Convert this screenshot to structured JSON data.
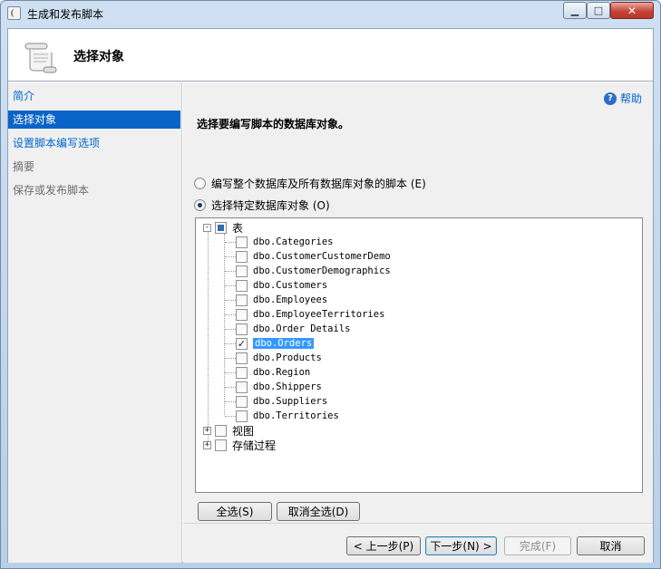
{
  "window": {
    "title": "生成和发布脚本",
    "buttons": {
      "minimize": "▁",
      "maximize": "□",
      "close": "✕"
    }
  },
  "header": {
    "title": "选择对象",
    "icon": "scroll-icon"
  },
  "nav": {
    "items": [
      {
        "label": "简介",
        "state": "link"
      },
      {
        "label": "选择对象",
        "state": "selected"
      },
      {
        "label": "设置脚本编写选项",
        "state": "link"
      },
      {
        "label": "摘要",
        "state": "disabled"
      },
      {
        "label": "保存或发布脚本",
        "state": "disabled"
      }
    ]
  },
  "main": {
    "help": "帮助",
    "instruction": "选择要编写脚本的数据库对象。",
    "radio_all": "编写整个数据库及所有数据库对象的脚本 (E)",
    "radio_specific": "选择特定数据库对象 (O)",
    "tree": {
      "tables_label": "表",
      "tables": [
        {
          "name": "dbo.Categories",
          "checked": false
        },
        {
          "name": "dbo.CustomerCustomerDemo",
          "checked": false
        },
        {
          "name": "dbo.CustomerDemographics",
          "checked": false
        },
        {
          "name": "dbo.Customers",
          "checked": false
        },
        {
          "name": "dbo.Employees",
          "checked": false
        },
        {
          "name": "dbo.EmployeeTerritories",
          "checked": false
        },
        {
          "name": "dbo.Order Details",
          "checked": false
        },
        {
          "name": "dbo.Orders",
          "checked": true
        },
        {
          "name": "dbo.Products",
          "checked": false
        },
        {
          "name": "dbo.Region",
          "checked": false
        },
        {
          "name": "dbo.Shippers",
          "checked": false
        },
        {
          "name": "dbo.Suppliers",
          "checked": false
        },
        {
          "name": "dbo.Territories",
          "checked": false
        }
      ],
      "views_label": "视图",
      "procs_label": "存储过程"
    },
    "select_all": "全选(S)",
    "deselect_all": "取消全选(D)"
  },
  "footer": {
    "prev": "< 上一步(P)",
    "next": "下一步(N) >",
    "finish": "完成(F)",
    "cancel": "取消"
  }
}
